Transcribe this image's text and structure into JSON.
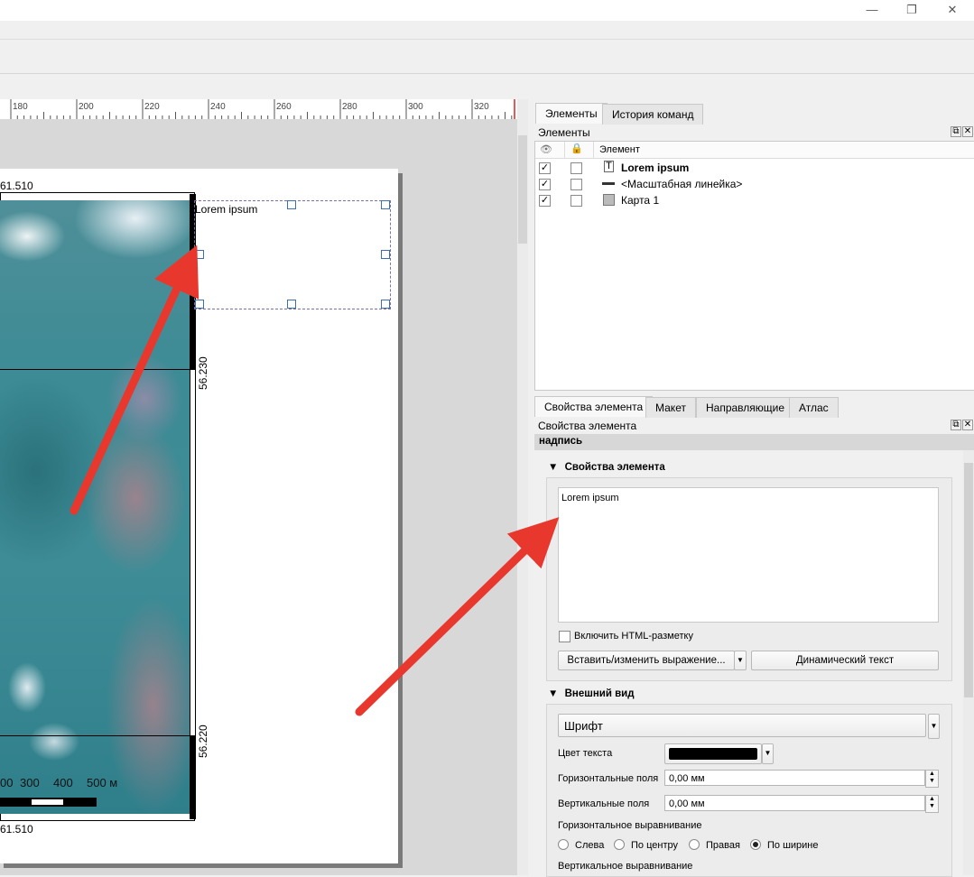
{
  "window": {
    "minimize": "—",
    "maximize": "❐",
    "close": "✕"
  },
  "ruler": {
    "ticks": [
      "180",
      "200",
      "220",
      "240",
      "260",
      "280",
      "300",
      "320"
    ]
  },
  "map": {
    "coord_top_left": "61.510",
    "coord_bottom_left": "61.510",
    "coord_right_mid": "56.230",
    "coord_right_bottom": "56.220",
    "scale_labels": [
      "00",
      "300",
      "400",
      "500 м"
    ],
    "label_text": "Lorem ipsum"
  },
  "elements_panel": {
    "tabs": [
      "Элементы",
      "История команд"
    ],
    "title": "Элементы",
    "column_element": "Элемент",
    "items": [
      {
        "label": "Lorem ipsum",
        "visible": "✓"
      },
      {
        "label": "<Масштабная линейка>",
        "visible": "✓"
      },
      {
        "label": "Карта 1",
        "visible": "✓"
      }
    ]
  },
  "props_panel": {
    "tabs": [
      "Свойства элемента",
      "Макет",
      "Направляющие",
      "Атлас"
    ],
    "title": "Свойства элемента",
    "subtitle": "надпись",
    "section_main": "Свойства элемента",
    "text_value": "Lorem ipsum",
    "html_checkbox": "Включить HTML-разметку",
    "insert_btn": "Вставить/изменить выражение...",
    "dynamic_btn": "Динамический текст",
    "section_appearance": "Внешний вид",
    "font_btn": "Шрифт",
    "text_color_label": "Цвет текста",
    "hmargin_label": "Горизонтальные поля",
    "hmargin_value": "0,00 мм",
    "vmargin_label": "Вертикальные поля",
    "vmargin_value": "0,00 мм",
    "halign_label": "Горизонтальное выравнивание",
    "halign_options": [
      "Слева",
      "По центру",
      "Правая",
      "По ширине"
    ],
    "valign_label": "Вертикальное выравнивание"
  },
  "colors": {
    "arrow": "#e8382e",
    "text_color": "#000000"
  }
}
